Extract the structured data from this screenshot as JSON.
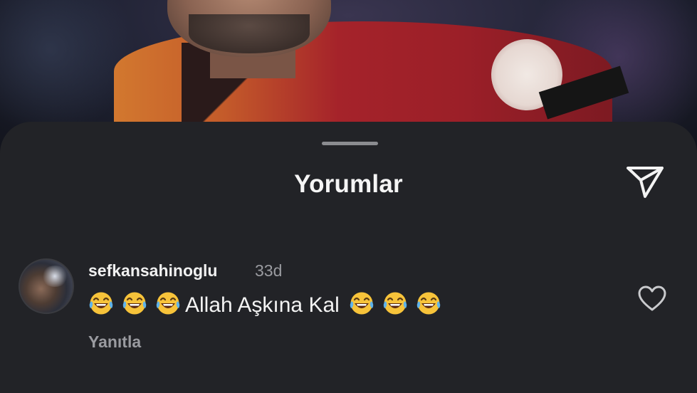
{
  "header": {
    "title": "Yorumlar",
    "share_icon": "paper-plane-icon"
  },
  "comment": {
    "username": "sefkansahinoglu",
    "time": "33d",
    "emoji_prefix": [
      "😂",
      "😂",
      "😂"
    ],
    "text": "Allah Aşkına Kal",
    "emoji_suffix": [
      "😂",
      "😂",
      "😂"
    ],
    "reply_label": "Yanıtla",
    "like_icon": "heart-outline-icon"
  },
  "colors": {
    "sheet_background": "#222327",
    "primary_text": "#f3f3f3",
    "secondary_text": "#9a9ba0"
  }
}
